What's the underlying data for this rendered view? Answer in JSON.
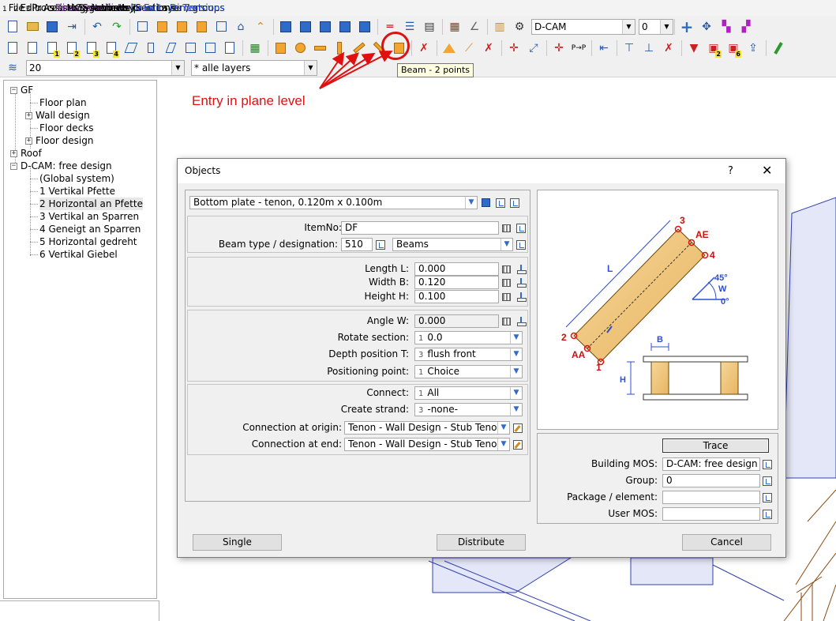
{
  "menu": [
    {
      "num": "1",
      "label": "File",
      "color": ""
    },
    {
      "num": "2",
      "label": "Edit",
      "color": ""
    },
    {
      "num": "3",
      "label": "Processes",
      "color": ""
    },
    {
      "num": "4",
      "label": "Assisting geometry",
      "color": ""
    },
    {
      "num": "5",
      "label": "Dimension lines",
      "color": "purple"
    },
    {
      "num": "6",
      "label": "MOS",
      "color": ""
    },
    {
      "num": "7",
      "label": "Systems",
      "color": ""
    },
    {
      "num": "8",
      "label": "Activate",
      "color": ""
    },
    {
      "num": "9",
      "label": "Views /Sections",
      "color": ""
    },
    {
      "num": "01",
      "label": "Help",
      "color": ""
    },
    {
      "num": "02",
      "label": "Draw",
      "color": "blue"
    },
    {
      "num": "03",
      "label": "Edit",
      "color": "blue"
    },
    {
      "num": "04",
      "label": "Layer / groups",
      "color": ""
    },
    {
      "num": "05",
      "label": "Dimensions",
      "color": "blue"
    },
    {
      "num": "06",
      "label": "Text",
      "color": "blue"
    }
  ],
  "toolbar": {
    "system_select": "D-CAM",
    "number_select": "0",
    "layer_number": "20",
    "layer_select": "* alle layers",
    "tooltip": "Beam - 2 points",
    "subscripts": [
      "1",
      "2",
      "3",
      "4"
    ],
    "sub_badges": [
      "2",
      "6"
    ]
  },
  "annotation": "Entry in plane level",
  "tree": {
    "gf": "GF",
    "floor_plan": "Floor plan",
    "wall_design": "Wall design",
    "floor_decks": "Floor decks",
    "floor_design": "Floor design",
    "roof": "Roof",
    "dcam": "D-CAM: free design",
    "global": "(Global system)",
    "sys1": "1 Vertikal Pfette",
    "sys2": "2 Horizontal an Pfette",
    "sys3": "3 Vertikal an Sparren",
    "sys4": "4 Geneigt an Sparren",
    "sys5": "5 Horizontal gedreht",
    "sys6": "6 Vertikal Giebel"
  },
  "dialog": {
    "title": "Objects",
    "help": "?",
    "close": "✕",
    "preset": "Bottom plate - tenon, 0.120m x 0.100m",
    "itemno_label": "ItemNo:",
    "itemno": "DF",
    "beamtype_label": "Beam type / designation:",
    "beamtype_code": "510",
    "beamtype_name": "Beams",
    "length_label": "Length L:",
    "length": "0.000",
    "width_label": "Width B:",
    "width": "0.120",
    "height_label": "Height H:",
    "height": "0.100",
    "angle_label": "Angle W:",
    "angle": "0.000",
    "rotate_label": "Rotate section:",
    "rotate_pre": "1",
    "rotate": "0.0",
    "depth_label": "Depth position T:",
    "depth_pre": "3",
    "depth": "flush front",
    "posp_label": "Positioning point:",
    "posp_pre": "1",
    "posp": "Choice",
    "connect_label": "Connect:",
    "connect_pre": "1",
    "connect": "All",
    "strand_label": "Create strand:",
    "strand_pre": "3",
    "strand": "-none-",
    "conn_origin_label": "Connection at origin:",
    "conn_origin": "Tenon - Wall Design - Stub Tenon",
    "conn_end_label": "Connection at end:",
    "conn_end": "Tenon - Wall Design - Stub Tenon",
    "trace": "Trace",
    "building_mos_label": "Building MOS:",
    "building_mos": "D-CAM: free design",
    "group_label": "Group:",
    "group": "0",
    "package_label": "Package / element:",
    "package": "",
    "usermos_label": "User MOS:",
    "usermos": "",
    "btn_single": "Single",
    "btn_distribute": "Distribute",
    "btn_cancel": "Cancel"
  },
  "diagram": {
    "p3": "3",
    "ae": "AE",
    "p4": "4",
    "l": "L",
    "deg45": "45°",
    "w": "W",
    "deg0": "0°",
    "p2": "2",
    "aa": "AA",
    "p1": "1",
    "b": "B",
    "h": "H"
  },
  "colors": {
    "accent_red": "#e01010",
    "beam_wood": "#f2c77a",
    "plane_fill": "#e4e7f7"
  }
}
